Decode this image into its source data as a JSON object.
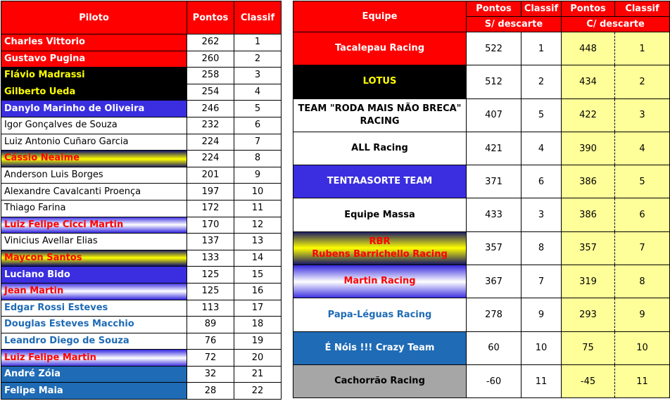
{
  "drivers": {
    "headers": {
      "name": "Piloto",
      "points": "Pontos",
      "rank": "Classif"
    },
    "rows": [
      {
        "name": "Charles Vittorio",
        "points": "262",
        "rank": "1",
        "style": "s-red"
      },
      {
        "name": "Gustavo Pugina",
        "points": "260",
        "rank": "2",
        "style": "s-red"
      },
      {
        "name": "Flávio Madrassi",
        "points": "258",
        "rank": "3",
        "style": "s-black"
      },
      {
        "name": "Gilberto Ueda",
        "points": "254",
        "rank": "4",
        "style": "s-black"
      },
      {
        "name": "Danylo Marinho de Oliveira",
        "points": "246",
        "rank": "5",
        "style": "s-blue"
      },
      {
        "name": "Igor Gonçalves de Souza",
        "points": "232",
        "rank": "6",
        "style": "s-white"
      },
      {
        "name": "Luiz Antonio Cuñaro Garcia",
        "points": "224",
        "rank": "7",
        "style": "s-white"
      },
      {
        "name": "Cássio Neaime",
        "points": "224",
        "rank": "8",
        "style": "s-yellowgrad"
      },
      {
        "name": "Anderson Luis Borges",
        "points": "201",
        "rank": "9",
        "style": "s-white"
      },
      {
        "name": "Alexandre Cavalcanti Proença",
        "points": "197",
        "rank": "10",
        "style": "s-white"
      },
      {
        "name": "Thiago Farina",
        "points": "172",
        "rank": "11",
        "style": "s-white"
      },
      {
        "name": "Luiz Felipe Cicci Martin",
        "points": "170",
        "rank": "12",
        "style": "s-purplegrad"
      },
      {
        "name": "Vinicius Avellar Elias",
        "points": "137",
        "rank": "13",
        "style": "s-white"
      },
      {
        "name": "Maycon Santos",
        "points": "133",
        "rank": "14",
        "style": "s-yellowgrad"
      },
      {
        "name": "Luciano Bido",
        "points": "125",
        "rank": "15",
        "style": "s-blue"
      },
      {
        "name": "Jean Martin",
        "points": "125",
        "rank": "16",
        "style": "s-purplegrad"
      },
      {
        "name": "Edgar Rossi Esteves",
        "points": "113",
        "rank": "17",
        "style": "s-bluetext"
      },
      {
        "name": "Douglas Esteves Macchio",
        "points": "89",
        "rank": "18",
        "style": "s-bluetext"
      },
      {
        "name": "Leandro Diego de Souza",
        "points": "76",
        "rank": "19",
        "style": "s-bluetext"
      },
      {
        "name": "Luiz Felipe Martin",
        "points": "72",
        "rank": "20",
        "style": "s-purplegrad"
      },
      {
        "name": "André Zóia",
        "points": "32",
        "rank": "21",
        "style": "s-steel"
      },
      {
        "name": "Felipe Maia",
        "points": "28",
        "rank": "22",
        "style": "s-steel"
      }
    ]
  },
  "teams": {
    "headers": {
      "team": "Equipe",
      "points1": "Pontos",
      "rank1": "Classif",
      "points2": "Pontos",
      "rank2": "Classif",
      "sub1": "S/ descarte",
      "sub2": "C/ descarte"
    },
    "rows": [
      {
        "name": "Tacalepau Racing",
        "name2": "",
        "p1": "522",
        "r1": "1",
        "p2": "448",
        "r2": "1",
        "style": "s-red"
      },
      {
        "name": "LOTUS",
        "name2": "",
        "p1": "512",
        "r1": "2",
        "p2": "434",
        "r2": "2",
        "style": "s-black"
      },
      {
        "name": "TEAM \"RODA MAIS NÃO BRECA\"",
        "name2": "RACING",
        "p1": "407",
        "r1": "5",
        "p2": "422",
        "r2": "3",
        "style": "s-whitebold"
      },
      {
        "name": "ALL Racing",
        "name2": "",
        "p1": "421",
        "r1": "4",
        "p2": "390",
        "r2": "4",
        "style": "s-whitebold"
      },
      {
        "name": "TENTAASORTE TEAM",
        "name2": "",
        "p1": "371",
        "r1": "6",
        "p2": "386",
        "r2": "5",
        "style": "s-blue"
      },
      {
        "name": "Equipe Massa",
        "name2": "",
        "p1": "433",
        "r1": "3",
        "p2": "386",
        "r2": "6",
        "style": "s-whitebold"
      },
      {
        "name": "RBR",
        "name2": "Rubens Barrichello Racing",
        "p1": "357",
        "r1": "8",
        "p2": "357",
        "r2": "7",
        "style": "s-yellowgrad"
      },
      {
        "name": "Martin Racing",
        "name2": "",
        "p1": "367",
        "r1": "7",
        "p2": "319",
        "r2": "8",
        "style": "s-purplegrad"
      },
      {
        "name": "Papa-Léguas Racing",
        "name2": "",
        "p1": "278",
        "r1": "9",
        "p2": "293",
        "r2": "9",
        "style": "s-bluetext"
      },
      {
        "name": "É Nóis !!! Crazy Team",
        "name2": "",
        "p1": "60",
        "r1": "10",
        "p2": "75",
        "r2": "10",
        "style": "s-steel"
      },
      {
        "name": "Cachorrão Racing",
        "name2": "",
        "p1": "-60",
        "r1": "11",
        "p2": "-45",
        "r2": "11",
        "style": "s-gray"
      }
    ]
  }
}
